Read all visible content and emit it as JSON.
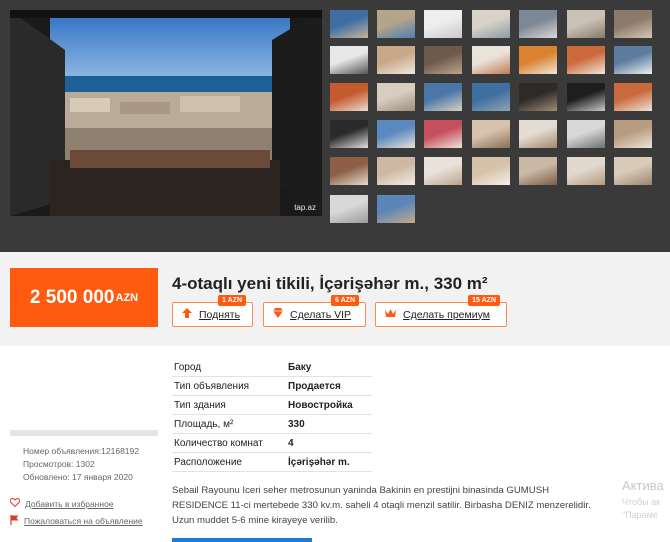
{
  "gallery": {
    "watermark": "tap.az",
    "thumbs": [
      {
        "c1": "#3d6fa3",
        "c2": "#c8b49a"
      },
      {
        "c1": "#b3a48a",
        "c2": "#4f7fb0"
      },
      {
        "c1": "#eeeeee",
        "c2": "#c9c9c9"
      },
      {
        "c1": "#d8d2c8",
        "c2": "#8e9aa6"
      },
      {
        "c1": "#7d8896",
        "c2": "#d9d9d9"
      },
      {
        "c1": "#c9c2b6",
        "c2": "#8a7a6a"
      },
      {
        "c1": "#8c7a6b",
        "c2": "#d6c7b5"
      },
      {
        "c1": "#e8e8e8",
        "c2": "#555555"
      },
      {
        "c1": "#c9a888",
        "c2": "#f0e8de"
      },
      {
        "c1": "#6e5a4a",
        "c2": "#b9a58f"
      },
      {
        "c1": "#e9e3da",
        "c2": "#c27a58"
      },
      {
        "c1": "#d9822f",
        "c2": "#efe6da"
      },
      {
        "c1": "#cc6a3d",
        "c2": "#f1e8dd"
      },
      {
        "c1": "#5c7da0",
        "c2": "#efefef"
      },
      {
        "c1": "#c55a2e",
        "c2": "#e9ddd0"
      },
      {
        "c1": "#d8cdbf",
        "c2": "#9e8d7b"
      },
      {
        "c1": "#4b77a8",
        "c2": "#d9d0c2"
      },
      {
        "c1": "#3f6ea0",
        "c2": "#8fa3b5"
      },
      {
        "c1": "#2e2a28",
        "c2": "#a08b78"
      },
      {
        "c1": "#1e1e1e",
        "c2": "#c9c9c9"
      },
      {
        "c1": "#c86a3b",
        "c2": "#efe4d8"
      },
      {
        "c1": "#2a2a2a",
        "c2": "#e0e0e0"
      },
      {
        "c1": "#5a89c0",
        "c2": "#e8e2d8"
      },
      {
        "c1": "#c64f5e",
        "c2": "#efe2d8"
      },
      {
        "c1": "#d7c2ad",
        "c2": "#8a6e55"
      },
      {
        "c1": "#e3dcd2",
        "c2": "#a5876c"
      },
      {
        "c1": "#d8d8d8",
        "c2": "#6e6e6e"
      },
      {
        "c1": "#b89c80",
        "c2": "#ede5da"
      },
      {
        "c1": "#8c5f46",
        "c2": "#e6dbce"
      },
      {
        "c1": "#cdb9a2",
        "c2": "#f2ece4"
      },
      {
        "c1": "#e8e2da",
        "c2": "#bba58d"
      },
      {
        "c1": "#d6c1a9",
        "c2": "#f5efe8"
      },
      {
        "c1": "#c8b8a4",
        "c2": "#7a5e48"
      },
      {
        "c1": "#e2d9ce",
        "c2": "#b59a80"
      },
      {
        "c1": "#d9cbb9",
        "c2": "#9c8470"
      },
      {
        "c1": "#d8d8d8",
        "c2": "#9a9a9a"
      },
      {
        "c1": "#5a86b8",
        "c2": "#c9a98a"
      }
    ]
  },
  "price": {
    "value": "2 500 000",
    "currency": "AZN"
  },
  "title": "4-otaqlı yeni tikili, İçərişəhər m., 330 m²",
  "actions": [
    {
      "label": "Поднять",
      "badge": "1 AZN",
      "icon": "arrow-up-icon",
      "color": "#ff5b10"
    },
    {
      "label": "Сделать VIP",
      "badge": "6 AZN",
      "icon": "diamond-icon",
      "color": "#ff5b10"
    },
    {
      "label": "Сделать премиум",
      "badge": "15 AZN",
      "icon": "crown-icon",
      "color": "#ff5b10"
    }
  ],
  "properties": [
    {
      "k": "Город",
      "v": "Баку"
    },
    {
      "k": "Тип объявления",
      "v": "Продается"
    },
    {
      "k": "Тип здания",
      "v": "Новостройка"
    },
    {
      "k": "Площадь, м²",
      "v": "330"
    },
    {
      "k": "Количество комнат",
      "v": "4"
    },
    {
      "k": "Расположение",
      "v": "İçərişəhər m."
    }
  ],
  "meta": {
    "ad_number": "Номер объявления:12168192",
    "views": "Просмотров: 1302",
    "updated": "Обновлено: 17 января 2020"
  },
  "links": {
    "favorite": "Добавить в избранное",
    "report": "Пожаловаться на объявление"
  },
  "description": [
    "Sebail Rayounu Iceri seher metrosunun yaninda Bakinin en prestijni binasinda GUMUSH",
    "RESIDENCE 11-ci mertebede 330 kv.m. saheli 4 otaqli menzil satilir. Birbasha DENIZ menzerelidir.",
    "Uzun muddet 5-6 mine kirayeye verilib."
  ],
  "windows_overlay": {
    "line1": "Актива",
    "line2": "Чтобы ак",
    "line3": "\"Параме"
  }
}
